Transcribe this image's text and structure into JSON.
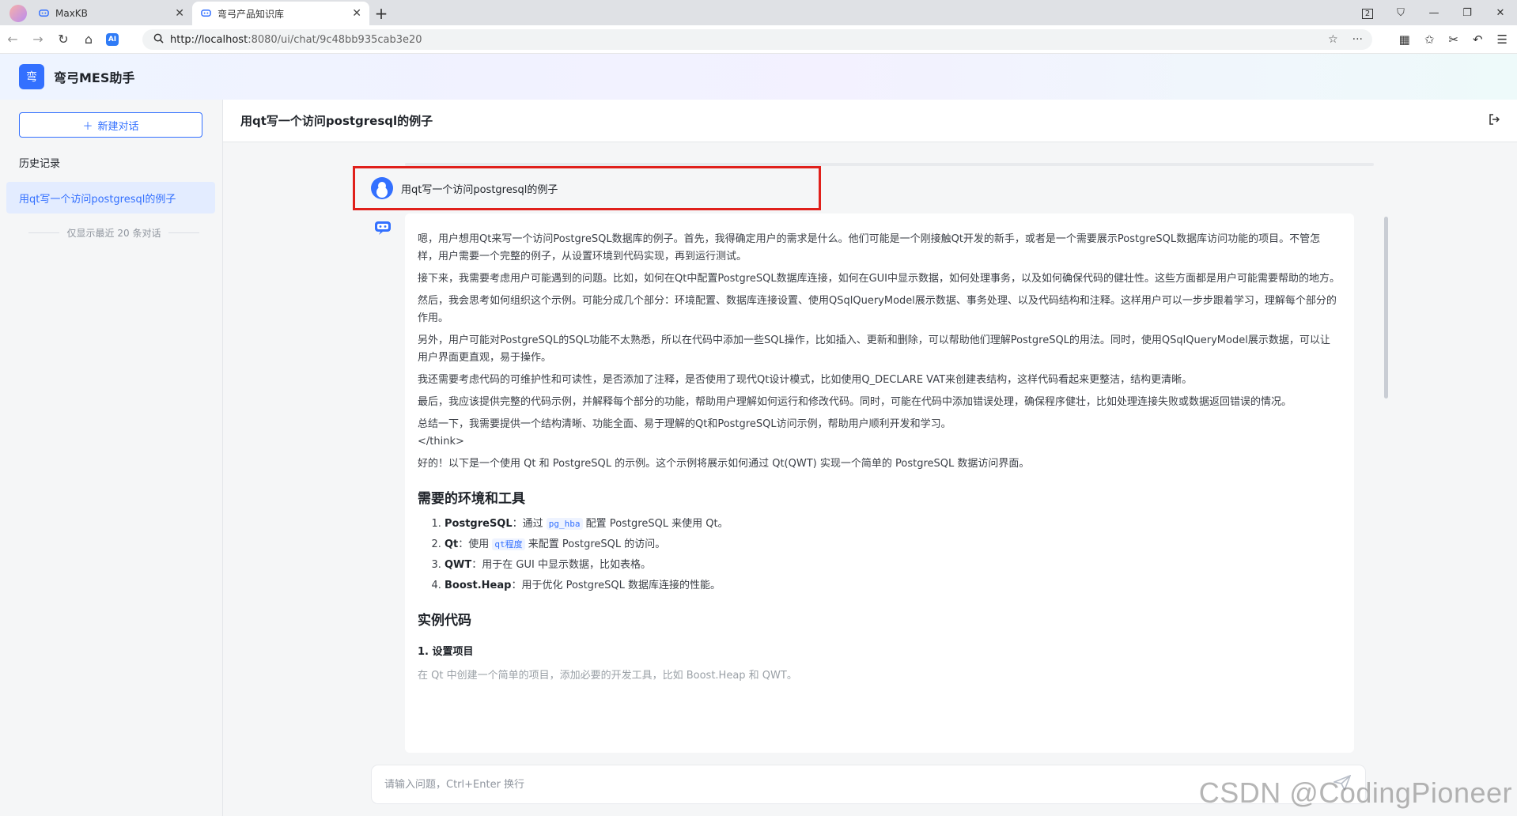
{
  "browser": {
    "tabs": [
      {
        "label": "MaxKB",
        "active": false
      },
      {
        "label": "弯弓产品知识库",
        "active": true
      }
    ],
    "url_host": "http://localhost",
    "url_rest": ":8080/ui/chat/9c48bb935cab3e20",
    "tab_count": "2"
  },
  "app": {
    "logo_char": "弯",
    "title": "弯弓MES助手"
  },
  "sidebar": {
    "new_chat_label": "新建对话",
    "history_label": "历史记录",
    "history_items": [
      "用qt写一个访问postgresql的例子"
    ],
    "history_note": "仅显示最近 20 条对话"
  },
  "chat": {
    "title": "用qt写一个访问postgresql的例子",
    "user_question": "用qt写一个访问postgresql的例子",
    "answer": {
      "paragraphs": [
        "嗯，用户想用Qt来写一个访问PostgreSQL数据库的例子。首先，我得确定用户的需求是什么。他们可能是一个刚接触Qt开发的新手，或者是一个需要展示PostgreSQL数据库访问功能的项目。不管怎样，用户需要一个完整的例子，从设置环境到代码实现，再到运行测试。",
        "接下来，我需要考虑用户可能遇到的问题。比如，如何在Qt中配置PostgreSQL数据库连接，如何在GUI中显示数据，如何处理事务，以及如何确保代码的健壮性。这些方面都是用户可能需要帮助的地方。",
        "然后，我会思考如何组织这个示例。可能分成几个部分：环境配置、数据库连接设置、使用QSqlQueryModel展示数据、事务处理、以及代码结构和注释。这样用户可以一步步跟着学习，理解每个部分的作用。",
        "另外，用户可能对PostgreSQL的SQL功能不太熟悉，所以在代码中添加一些SQL操作，比如插入、更新和删除，可以帮助他们理解PostgreSQL的用法。同时，使用QSqlQueryModel展示数据，可以让用户界面更直观，易于操作。",
        "我还需要考虑代码的可维护性和可读性，是否添加了注释，是否使用了现代Qt设计模式，比如使用Q_DECLARE VAT来创建表结构，这样代码看起来更整洁，结构更清晰。",
        "最后，我应该提供完整的代码示例，并解释每个部分的功能，帮助用户理解如何运行和修改代码。同时，可能在代码中添加错误处理，确保程序健壮，比如处理连接失败或数据返回错误的情况。",
        "总结一下，我需要提供一个结构清晰、功能全面、易于理解的Qt和PostgreSQL访问示例，帮助用户顺利开发和学习。"
      ],
      "think_end": "</think>",
      "intro": "好的！以下是一个使用 Qt 和 PostgreSQL 的示例。这个示例将展示如何通过 Qt(QWT) 实现一个简单的 PostgreSQL 数据访问界面。",
      "section1_title": "需要的环境和工具",
      "tools": [
        {
          "name": "PostgreSQL",
          "pre": "：通过 ",
          "code": "pg_hba",
          "post": " 配置 PostgreSQL 来使用 Qt。"
        },
        {
          "name": "Qt",
          "pre": "：使用 ",
          "code": "qt程度",
          "post": " 来配置 PostgreSQL 的访问。"
        },
        {
          "name": "QWT",
          "pre": "：用于在 GUI 中显示数据，比如表格。",
          "code": "",
          "post": ""
        },
        {
          "name": "Boost.Heap",
          "pre": "：用于优化 PostgreSQL 数据库连接的性能。",
          "code": "",
          "post": ""
        }
      ],
      "section2_title": "实例代码",
      "sub1_title": "1. 设置项目",
      "sub1_text": "在 Qt 中创建一个简单的项目，添加必要的开发工具，比如 Boost.Heap 和 QWT。"
    },
    "input_placeholder": "请输入问题，Ctrl+Enter 换行"
  },
  "watermark": "CSDN @CodingPioneer",
  "colors": {
    "accent": "#3370ff",
    "highlight_box": "#e0201b"
  }
}
